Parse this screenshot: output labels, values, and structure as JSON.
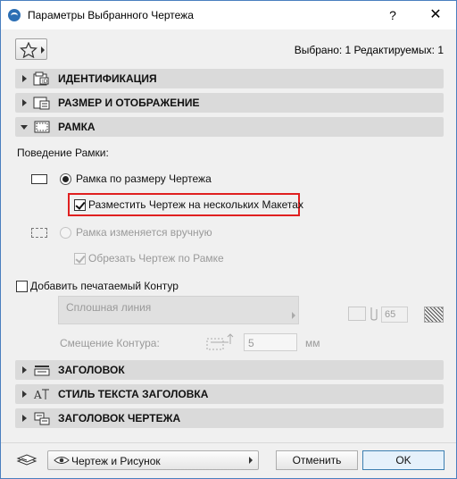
{
  "window": {
    "title": "Параметры Выбранного Чертежа",
    "help_label": "?",
    "close_label": "✕"
  },
  "header": {
    "selection_info": "Выбрано: 1 Редактируемых: 1"
  },
  "sections": {
    "identification": "ИДЕНТИФИКАЦИЯ",
    "size_display": "РАЗМЕР И ОТОБРАЖЕНИЕ",
    "frame": "РАМКА",
    "title_panel": "ЗАГОЛОВОК",
    "title_text_style": "СТИЛЬ ТЕКСТА ЗАГОЛОВКА",
    "drawing_title": "ЗАГОЛОВОК ЧЕРТЕЖА"
  },
  "frame": {
    "behavior_label": "Поведение Рамки:",
    "option_fit": "Рамка по размеру Чертежа",
    "option_fit_selected": true,
    "place_multi_label": "Разместить Чертеж на нескольких Макетах",
    "place_multi_checked": true,
    "option_manual": "Рамка изменяется вручную",
    "option_manual_selected": false,
    "clip_label": "Обрезать Чертеж по Рамке",
    "clip_checked": true,
    "add_border_label": "Добавить печатаемый Контур",
    "add_border_checked": false,
    "line_type": "Сплошная линия",
    "pen_number": "65",
    "offset_label": "Смещение Контура:",
    "offset_value": "5",
    "offset_unit": "мм"
  },
  "footer": {
    "view_option": "Чертеж и Рисунок",
    "cancel_label": "Отменить",
    "ok_label": "OK"
  },
  "icons": {
    "favorites": "star-icon",
    "layer": "layer-icon",
    "visibility": "eye-icon"
  },
  "colors": {
    "highlight_border": "#e02020",
    "section_bg": "#dadada",
    "ok_border": "#3c7fb1"
  }
}
